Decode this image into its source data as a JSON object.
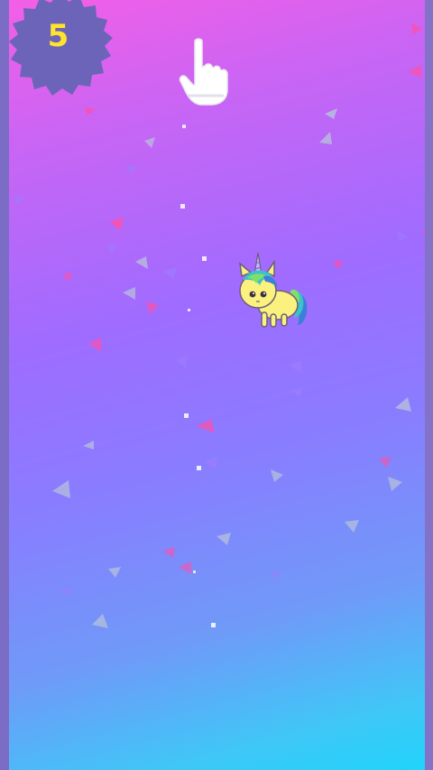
{
  "game": {
    "score": "5",
    "colors": {
      "gradient_top": "#f45fe6",
      "gradient_mid": "#9f6cff",
      "gradient_bottom": "#1fd4fb",
      "wall": "#7b6cc6",
      "badge": "#6b64b8",
      "score_text": "#ffe42e",
      "unicorn_body": "#fbf17e",
      "mane_green": "#7ee06a",
      "mane_teal": "#3cc2c8",
      "mane_blue": "#3b7fd6"
    },
    "icons": {
      "score_badge": "spiky-badge-icon",
      "tap_hint": "tap-hand-icon",
      "player": "unicorn-icon"
    }
  }
}
